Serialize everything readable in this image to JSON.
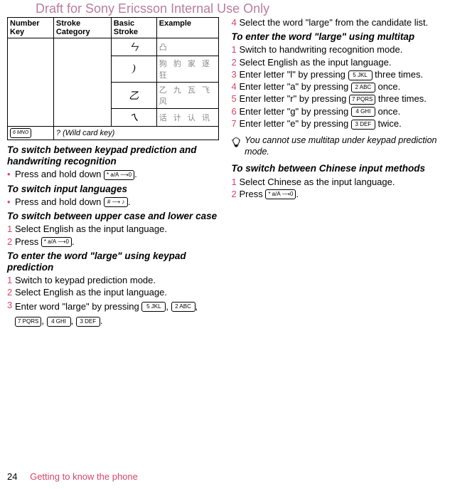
{
  "watermark": "Draft for Sony Ericsson Internal Use Only",
  "table": {
    "headers": [
      "Number Key",
      "Stroke Category",
      "Basic Stroke",
      "Example"
    ],
    "rows": [
      {
        "stroke": "ㄣ",
        "example": "凸"
      },
      {
        "stroke": ")",
        "example": "狗 豹 家 逐 狂"
      },
      {
        "stroke": "乙",
        "example": "乙 九 瓦 飞 风"
      },
      {
        "stroke": "ㄟ",
        "example": "话 计 认 讯"
      }
    ],
    "wildcard_key": "6 MNO",
    "wildcard_text": "? (Wild card key)"
  },
  "left": {
    "h1": "To switch between keypad prediction and handwriting recognition",
    "s1": "Press and hold down ",
    "key1": "* a/A ⟶0",
    "s1end": ".",
    "h2": "To switch input languages",
    "s2": "Press and hold down ",
    "key2": "# ⟶ ♪",
    "s2end": ".",
    "h3": "To switch between upper case and lower case",
    "s3a_num": "1",
    "s3a": "Select English as the input language.",
    "s3b_num": "2",
    "s3b": "Press ",
    "key3": "* a/A ⟶0",
    "s3bend": ".",
    "h4": "To enter the word \"large\" using keypad prediction",
    "s4a_num": "1",
    "s4a": "Switch to keypad prediction mode.",
    "s4b_num": "2",
    "s4b": "Select English as the input language.",
    "s4c_num": "3",
    "s4c": "Enter word \"large\" by pressing ",
    "k5": "5 JKL",
    "k2": "2 ABC",
    "k7": "7 PQRS",
    "k4": "4 GHI",
    "k3": "3 DEF",
    "comma": ", ",
    "period": "."
  },
  "right": {
    "s0_num": "4",
    "s0": "Select the word \"large\" from the candidate list.",
    "h1": "To enter the word \"large\" using multitap",
    "s1_num": "1",
    "s1": "Switch to handwriting recognition mode.",
    "s2_num": "2",
    "s2": "Select English as the input language.",
    "s3_num": "3",
    "s3a": "Enter letter \"l\" by pressing ",
    "s3b": " three times.",
    "s4_num": "4",
    "s4a": "Enter letter \"a\" by pressing ",
    "s4b": " once.",
    "s5_num": "5",
    "s5a": "Enter letter \"r\" by pressing ",
    "s5b": " three times.",
    "s6_num": "6",
    "s6a": "Enter letter \"g\" by pressing ",
    "s6b": " once.",
    "s7_num": "7",
    "s7a": "Enter letter \"e\" by pressing ",
    "s7b": " twice.",
    "tip": "You cannot use multitap under keypad prediction mode.",
    "h2": "To switch between Chinese input methods",
    "s8_num": "1",
    "s8": "Select Chinese as the input language.",
    "s9_num": "2",
    "s9a": "Press ",
    "s9b": ".",
    "key_star": "* a/A ⟶0"
  },
  "footer": {
    "page": "24",
    "text": "Getting to know the phone"
  }
}
